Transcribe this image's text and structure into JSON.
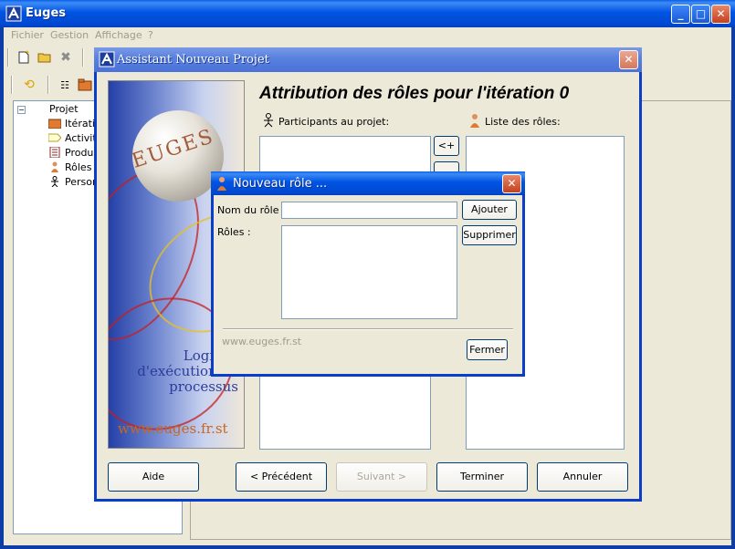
{
  "main": {
    "title": "Euges",
    "caption_buttons": {
      "minimize": "_",
      "maximize": "□",
      "close": "✕"
    },
    "menu": [
      "Fichier",
      "Gestion",
      "Affichage",
      "?"
    ],
    "tree": {
      "root": "Projet",
      "items": [
        "Itérati",
        "Activit",
        "Produi",
        "Rôles",
        "Person"
      ]
    }
  },
  "wizard": {
    "title": "Assistant Nouveau Projet",
    "heading": "Attribution des rôles pour l'itération 0",
    "participants_label": "Participants au projet:",
    "roles_list_label": "Liste des rôles:",
    "add_arrow": "<+",
    "banner": {
      "sphere_text": "EUGES",
      "tagline": "Logiciel d'exécution de processus",
      "url": "www.euges.fr.st"
    },
    "buttons": {
      "help": "Aide",
      "previous": "< Précédent",
      "next": "Suivant >",
      "finish": "Terminer",
      "cancel": "Annuler"
    }
  },
  "dialog": {
    "title": "Nouveau rôle ...",
    "role_name_label": "Nom du rôle :",
    "role_name_value": "",
    "roles_label": "Rôles :",
    "add_button": "Ajouter",
    "delete_button": "Supprimer",
    "footer_url": "www.euges.fr.st",
    "close_button": "Fermer"
  },
  "colors": {
    "xp_blue": "#0054e3",
    "close_red": "#c5401d",
    "face": "#ece9d8"
  }
}
